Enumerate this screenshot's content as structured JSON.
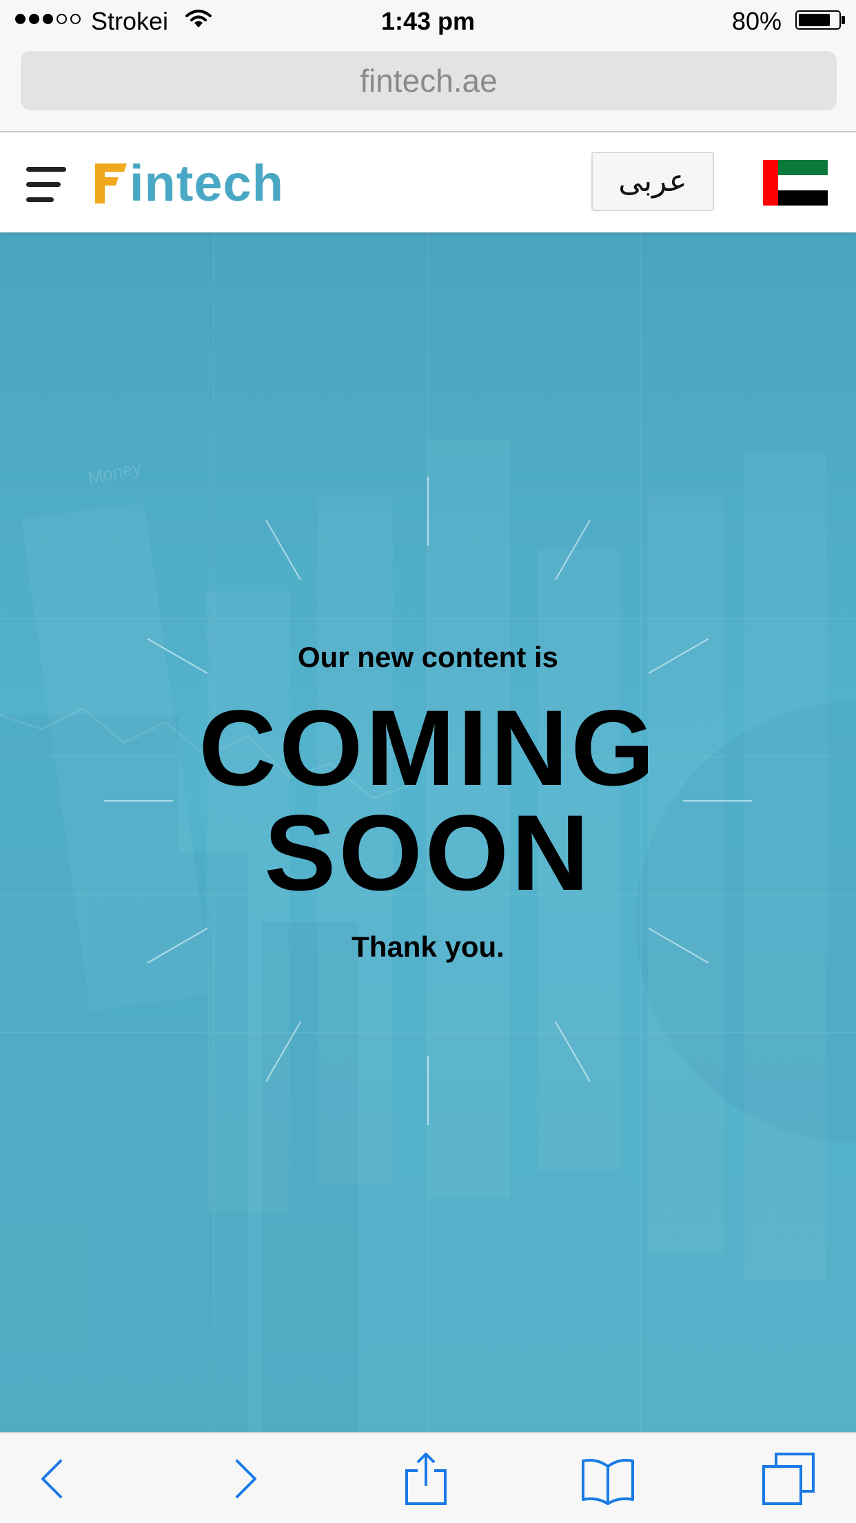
{
  "status_bar": {
    "carrier": "Strokei",
    "time": "1:43 pm",
    "battery_percent": "80%",
    "battery_level": 0.8,
    "signal_bars_filled": 3,
    "signal_bars_total": 5
  },
  "browser": {
    "url": "fintech.ae"
  },
  "header": {
    "logo_text": "intech",
    "language_button": "عربى",
    "flag_icon": "uae-flag-icon",
    "menu_icon": "hamburger-menu-icon"
  },
  "hero": {
    "subtitle": "Our new content is",
    "headline_line1": "COMING",
    "headline_line2": "SOON",
    "thanks": "Thank you.",
    "background_watermark": "Money"
  },
  "toolbar": {
    "icons": [
      "back-icon",
      "forward-icon",
      "share-icon",
      "bookmarks-icon",
      "tabs-icon"
    ]
  },
  "colors": {
    "brand_teal": "#4aa8c4",
    "brand_orange": "#f0a81c",
    "hero_background": "#55b0c8",
    "ios_blue": "#1a7ae6"
  }
}
